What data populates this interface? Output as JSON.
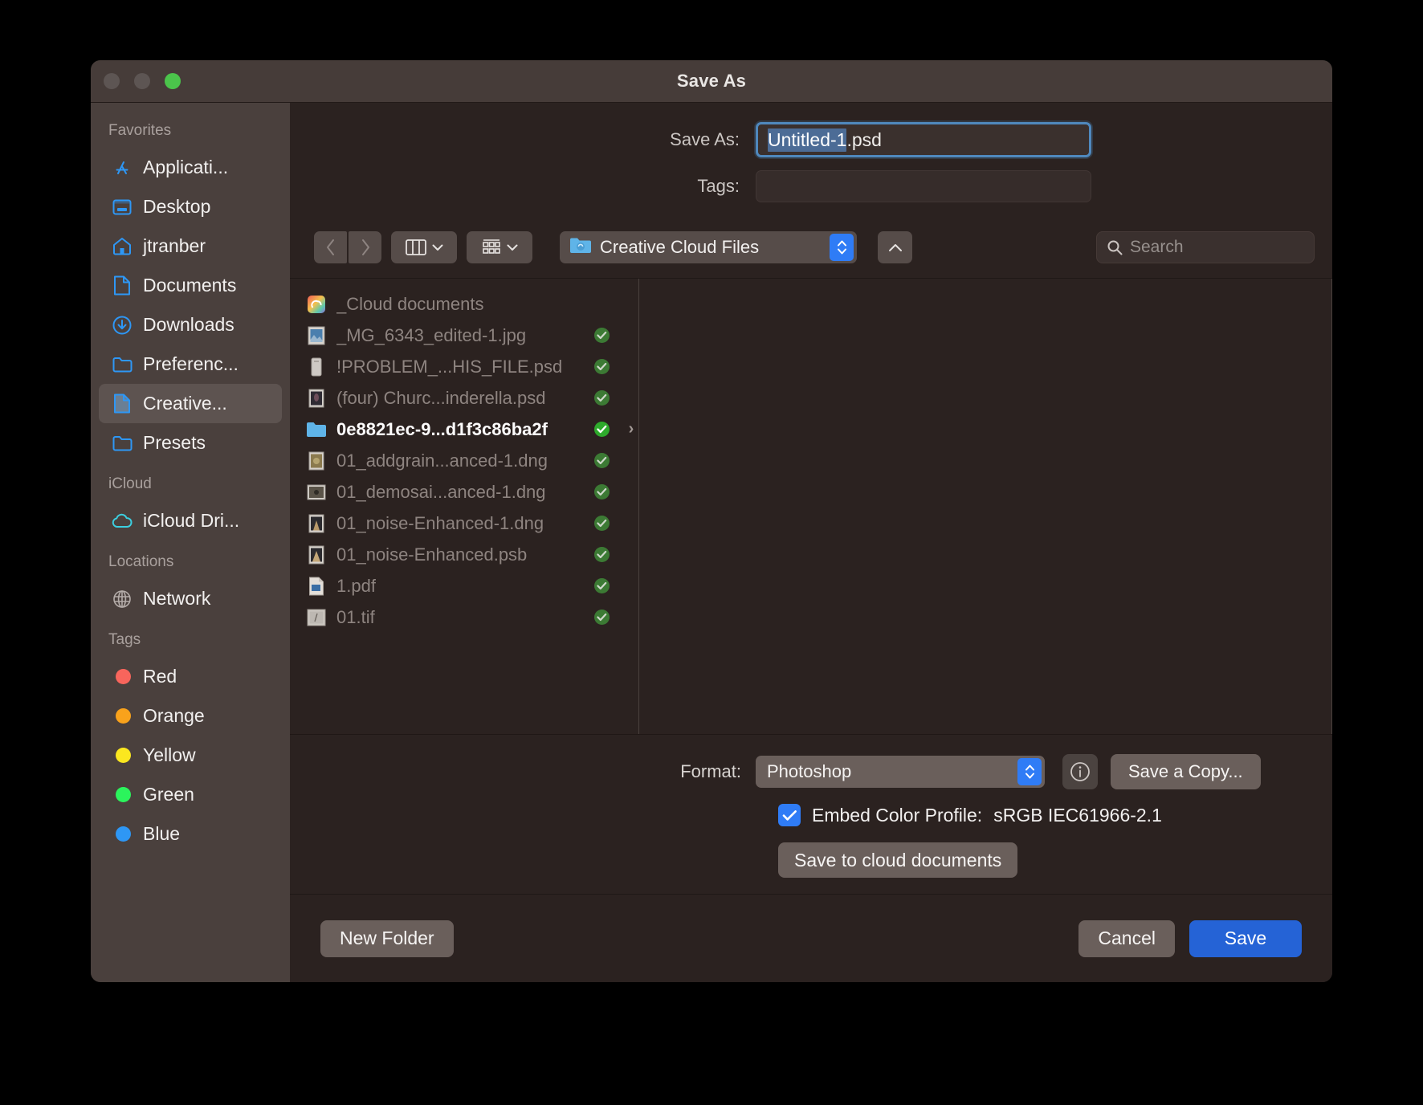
{
  "window": {
    "title": "Save As",
    "traffic_lights": [
      "close",
      "minimize",
      "maximize"
    ]
  },
  "fields": {
    "save_as_label": "Save As:",
    "filename_selected": "Untitled-1",
    "filename_extension": ".psd",
    "filename_full": "Untitled-1.psd",
    "tags_label": "Tags:",
    "tags_value": ""
  },
  "toolbar": {
    "back": "‹",
    "forward": "›",
    "path_label": "Creative Cloud Files",
    "search_placeholder": "Search"
  },
  "sidebar": {
    "sections": [
      {
        "header": "Favorites",
        "items": [
          {
            "label": "Applicati...",
            "icon": "applications-icon",
            "selected": false
          },
          {
            "label": "Desktop",
            "icon": "desktop-icon",
            "selected": false
          },
          {
            "label": "jtranber",
            "icon": "home-icon",
            "selected": false
          },
          {
            "label": "Documents",
            "icon": "document-icon",
            "selected": false
          },
          {
            "label": "Downloads",
            "icon": "downloads-icon",
            "selected": false
          },
          {
            "label": "Preferenc...",
            "icon": "folder-icon",
            "selected": false
          },
          {
            "label": "Creative...",
            "icon": "document-icon",
            "selected": true
          },
          {
            "label": "Presets",
            "icon": "folder-icon",
            "selected": false
          }
        ]
      },
      {
        "header": "iCloud",
        "items": [
          {
            "label": "iCloud Dri...",
            "icon": "cloud-icon",
            "selected": false
          }
        ]
      },
      {
        "header": "Locations",
        "items": [
          {
            "label": "Network",
            "icon": "globe-icon",
            "selected": false
          }
        ]
      },
      {
        "header": "Tags",
        "items": [
          {
            "label": "Red",
            "icon": "tag-dot-icon",
            "color": "#f8655c",
            "selected": false
          },
          {
            "label": "Orange",
            "icon": "tag-dot-icon",
            "color": "#f9a21b",
            "selected": false
          },
          {
            "label": "Yellow",
            "icon": "tag-dot-icon",
            "color": "#fbe71f",
            "selected": false
          },
          {
            "label": "Green",
            "icon": "tag-dot-icon",
            "color": "#2bf45c",
            "selected": false
          },
          {
            "label": "Blue",
            "icon": "tag-dot-icon",
            "color": "#2e97f5",
            "selected": false
          }
        ]
      }
    ]
  },
  "files": [
    {
      "name": "_Cloud documents",
      "icon": "creative-cloud-icon",
      "enabled": false,
      "badge": false,
      "chevron": false
    },
    {
      "name": "_MG_6343_edited-1.jpg",
      "icon": "photo-icon",
      "enabled": false,
      "badge": true,
      "chevron": false
    },
    {
      "name": "!PROBLEM_...HIS_FILE.psd",
      "icon": "generic-doc-icon",
      "enabled": false,
      "badge": true,
      "chevron": false
    },
    {
      "name": "(four) Churc...inderella.psd",
      "icon": "photo-icon",
      "enabled": false,
      "badge": true,
      "chevron": false
    },
    {
      "name": "0e8821ec-9...d1f3c86ba2f",
      "icon": "folder-icon",
      "enabled": true,
      "badge": true,
      "chevron": true
    },
    {
      "name": "01_addgrain...anced-1.dng",
      "icon": "photo-icon",
      "enabled": false,
      "badge": true,
      "chevron": false
    },
    {
      "name": "01_demosai...anced-1.dng",
      "icon": "photo-icon",
      "enabled": false,
      "badge": true,
      "chevron": false
    },
    {
      "name": "01_noise-Enhanced-1.dng",
      "icon": "photo-icon",
      "enabled": false,
      "badge": true,
      "chevron": false
    },
    {
      "name": "01_noise-Enhanced.psb",
      "icon": "photo-icon",
      "enabled": false,
      "badge": true,
      "chevron": false
    },
    {
      "name": "1.pdf",
      "icon": "pdf-icon",
      "enabled": false,
      "badge": true,
      "chevron": false
    },
    {
      "name": "01.tif",
      "icon": "tif-icon",
      "enabled": false,
      "badge": true,
      "chevron": false
    }
  ],
  "options": {
    "format_label": "Format:",
    "format_value": "Photoshop",
    "save_a_copy_label": "Save a Copy...",
    "embed_profile_label": "Embed Color Profile:",
    "embed_profile_value": "sRGB IEC61966-2.1",
    "embed_profile_checked": true,
    "cloud_button_label": "Save to cloud documents"
  },
  "footer": {
    "new_folder_label": "New Folder",
    "cancel_label": "Cancel",
    "save_label": "Save"
  },
  "colors": {
    "accent_blue": "#2f7cf6",
    "save_button_blue": "#2563d6",
    "selection_blue": "#4c6c96",
    "sidebar_bg": "#4a403d",
    "window_bg": "#2b2220",
    "badge_green": "#3c7a34"
  }
}
